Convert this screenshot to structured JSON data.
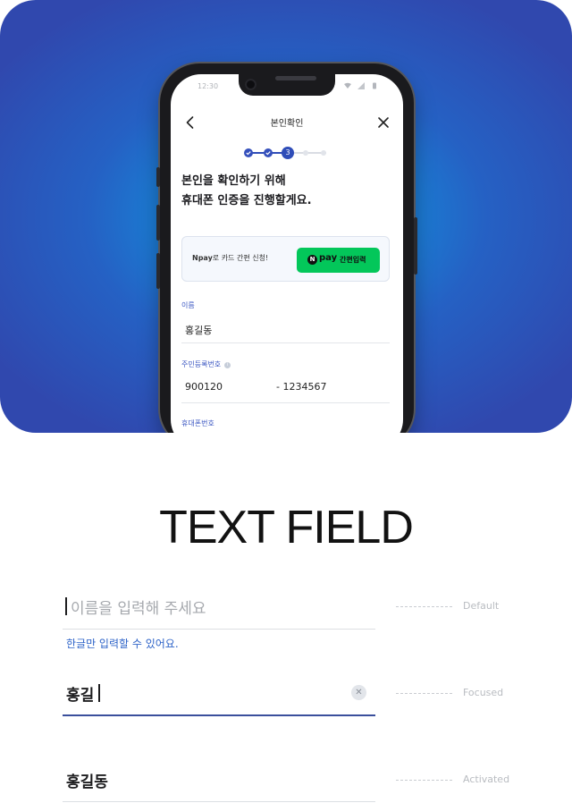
{
  "phone": {
    "status_time": "12:30",
    "nav": {
      "title": "본인확인",
      "back_icon": "chevron-left-icon",
      "close_icon": "close-icon"
    },
    "stepper": {
      "total_steps": 5,
      "current_step": 3,
      "current_label": "3"
    },
    "headline": {
      "line1": "본인을 확인하기 위해",
      "line2": "휴대폰 인증을 진행할게요."
    },
    "promo": {
      "text_bold": "Npay",
      "text_rest": "로 카드 간편 신청!",
      "button": {
        "badge": "N",
        "word": "pay",
        "label": "간편입력",
        "color": "#03c75a"
      }
    },
    "form": {
      "name_label": "이름",
      "name_value": "홍길동",
      "rrn_label": "주민등록번호",
      "rrn_front": "900120",
      "rrn_back": "- 1234567",
      "phone_label": "휴대폰번호"
    }
  },
  "section_title": "TEXT FIELD",
  "text_fields": {
    "default": {
      "placeholder": "이름을 입력해 주세요",
      "helper": "한글만 입력할 수 있어요.",
      "state": "Default"
    },
    "focused": {
      "value": "홍길",
      "state": "Focused"
    },
    "activated": {
      "value": "홍길동",
      "state": "Activated"
    }
  },
  "colors": {
    "accent": "#2f4db8",
    "helper": "#2d63c8",
    "focus_line": "#3a4f9c",
    "hero_center": "#1e9ee6",
    "hero_edge": "#3048ae"
  }
}
